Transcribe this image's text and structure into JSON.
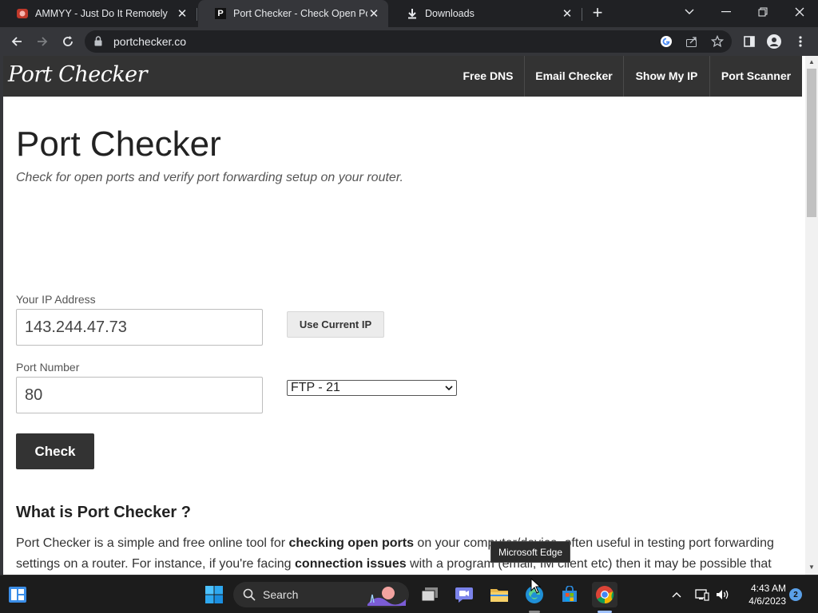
{
  "browser": {
    "tabs": [
      {
        "title": "AMMYY - Just Do It Remotely",
        "icon": "ammyy-icon",
        "active": false
      },
      {
        "title": "Port Checker - Check Open Ports",
        "icon": "portchecker-favicon",
        "favicon_letter": "P",
        "active": true
      },
      {
        "title": "Downloads",
        "icon": "download-icon",
        "active": false
      }
    ],
    "new_tab_label": "+",
    "url": "portchecker.co"
  },
  "site": {
    "logo": "Port Checker",
    "nav": [
      "Free DNS",
      "Email Checker",
      "Show My IP",
      "Port Scanner"
    ],
    "title": "Port Checker",
    "subtitle": "Check for open ports and verify port forwarding setup on your router.",
    "form": {
      "ip_label": "Your IP Address",
      "ip_value": "143.244.47.73",
      "use_current_ip": "Use Current IP",
      "port_label": "Port Number",
      "port_value": "80",
      "service_selected": "FTP - 21",
      "check_button": "Check"
    },
    "section_heading": "What is Port Checker ?",
    "paragraph": {
      "p1": "Port Checker is a simple and free online tool for ",
      "b1": "checking open ports",
      "p2": " on your computer/device, often useful in testing port forwarding settings on a router. For instance, if you're facing ",
      "b2": "connection issues",
      "p3": " with a program (email, IM client etc) then it may be possible that"
    }
  },
  "tooltip": "Microsoft Edge",
  "taskbar": {
    "search_label": "Search",
    "time": "4:43 AM",
    "date": "4/6/2023",
    "notifications": "2"
  }
}
